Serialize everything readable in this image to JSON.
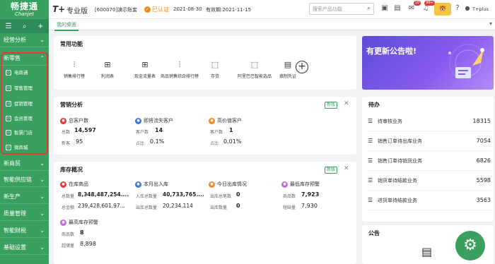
{
  "app": {
    "logo_text": "畅捷通",
    "logo_sub": "Chanjet",
    "t_logo": "T+",
    "edition": "专业版",
    "account": "[600070]演示账套",
    "cert": "已认证",
    "date": "2021-08-30",
    "valid": "有效期:2021-11-15",
    "user": "T+plus"
  },
  "search": {
    "placeholder": "搜索产品功能"
  },
  "badges": {
    "msg": "10",
    "notif": "99+"
  },
  "tab": {
    "label": "我的桌面"
  },
  "sidebar": {
    "items": [
      {
        "label": "经营分析"
      },
      {
        "label": "新零售"
      },
      {
        "label": "新商贸"
      },
      {
        "label": "智能供应链"
      },
      {
        "label": "新生产"
      },
      {
        "label": "质量管理"
      },
      {
        "label": "智能财税"
      },
      {
        "label": "基础设置"
      }
    ],
    "subs": [
      {
        "label": "电商通"
      },
      {
        "label": "零售管理"
      },
      {
        "label": "促销管理"
      },
      {
        "label": "会员管理"
      },
      {
        "label": "智慧门店"
      },
      {
        "label": "微商城"
      }
    ]
  },
  "common": {
    "title": "常用功能",
    "items": [
      {
        "label": "销售排行榜"
      },
      {
        "label": "利润表"
      },
      {
        "label": "现金流量表"
      },
      {
        "label": "商品销售综合排行榜"
      },
      {
        "label": "存货"
      },
      {
        "label": "阿里巴巴智能选品"
      },
      {
        "label": "填制凭证"
      }
    ]
  },
  "marketing": {
    "title": "营销分析",
    "new": "新版",
    "groups": [
      {
        "title": "总客户数",
        "l1": "总数",
        "v1": "14,597",
        "l2": "新客",
        "v2": "95"
      },
      {
        "title": "即将流失客户",
        "l1": "客户数",
        "v1": "14",
        "l2": "占比",
        "v2": "0.1%"
      },
      {
        "title": "高价值客户",
        "l1": "客户数",
        "v1": "1",
        "l2": "占比",
        "v2": "0.01%"
      }
    ]
  },
  "inventory": {
    "title": "库存概况",
    "new": "新版",
    "groups": [
      {
        "title": "在库商品",
        "l1": "总数量",
        "v1": "8,348,487,254....",
        "l2": "总金额",
        "v2": "239,428,601,97..."
      },
      {
        "title": "本月出入库",
        "l1": "入库总数量",
        "v1": "40,733,765....",
        "l2": "出库总数量",
        "v2": "20,234.114"
      },
      {
        "title": "今日出库情况",
        "l1": "出库总笔数",
        "v1": "0",
        "l2": "出库数量",
        "v2": "0"
      },
      {
        "title": "最低库存预警",
        "l1": "商品数",
        "v1": "7,923",
        "l2": "短缺量",
        "v2": "7,930"
      },
      {
        "title": "最高库存预警",
        "l1": "商品数",
        "v1": "8",
        "l2": "超储量",
        "v2": "8,898"
      }
    ]
  },
  "banner": {
    "text": "有更新公告啦!"
  },
  "todo": {
    "title": "待办",
    "items": [
      {
        "label": "待审核业务",
        "value": "18315"
      },
      {
        "label": "销售订单待出库业务",
        "value": "7054"
      },
      {
        "label": "销售订单待销货业务",
        "value": "6826"
      },
      {
        "label": "销货单待结款业务",
        "value": "5598"
      },
      {
        "label": "进货单待结款业务",
        "value": "3563"
      }
    ]
  },
  "notice": {
    "title": "公告"
  },
  "colors": {
    "brand": "#3aa060",
    "accent": "#f08a24",
    "alert": "#e53935"
  }
}
